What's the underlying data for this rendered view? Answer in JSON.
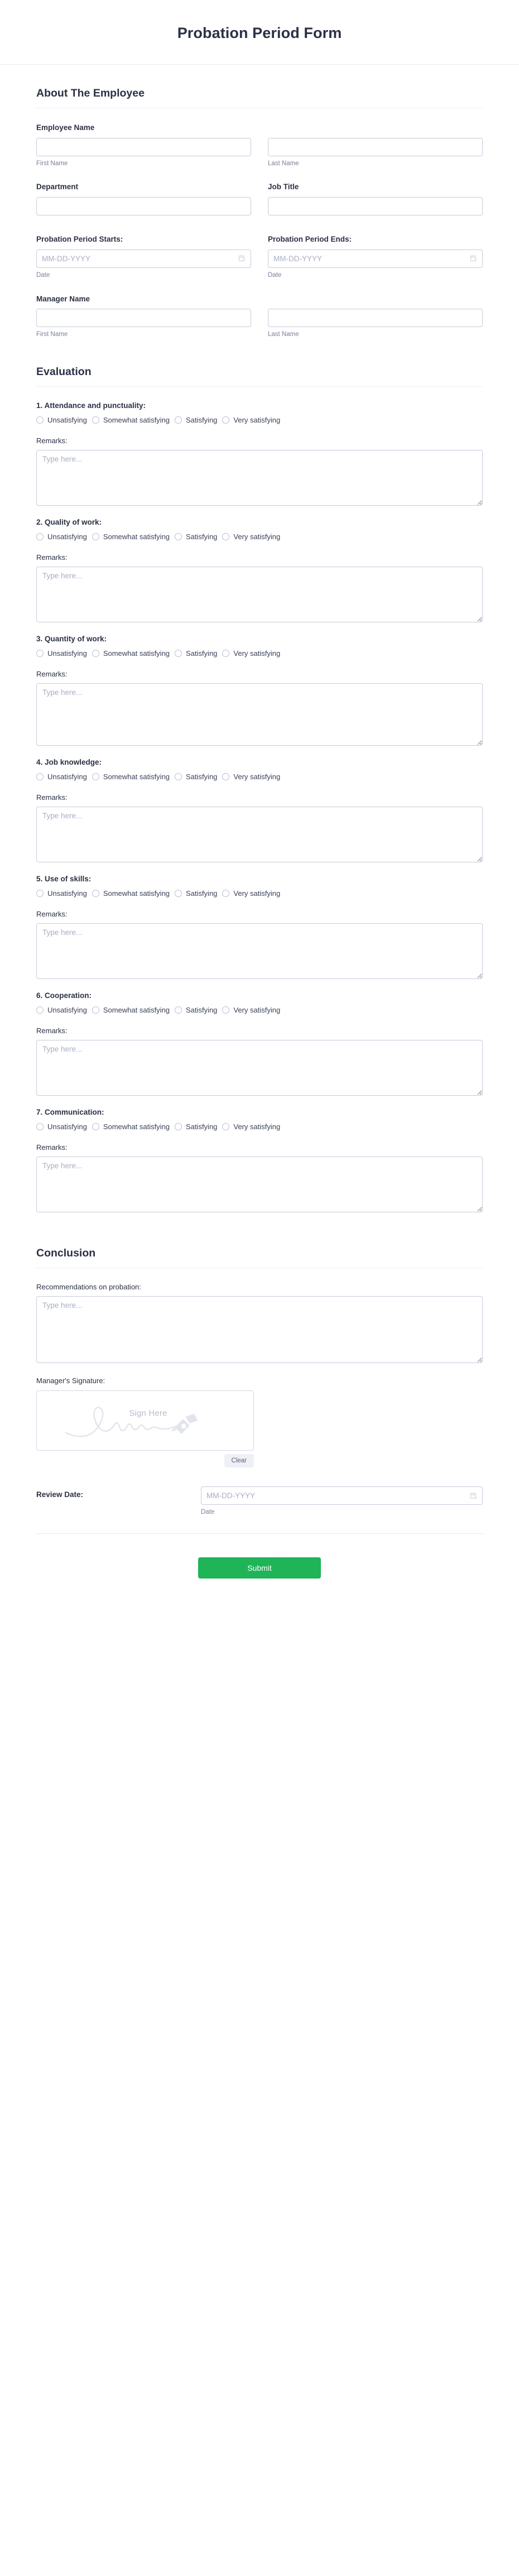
{
  "header": {
    "title": "Probation Period Form"
  },
  "sections": {
    "about": {
      "heading": "About The Employee",
      "employee_name": {
        "label": "Employee Name",
        "first_sub": "First Name",
        "last_sub": "Last Name",
        "first_value": "",
        "last_value": "",
        "first_placeholder": "",
        "last_placeholder": ""
      },
      "department": {
        "label": "Department",
        "value": "",
        "placeholder": ""
      },
      "job_title": {
        "label": "Job Title",
        "value": "",
        "placeholder": ""
      },
      "probation_start": {
        "label": "Probation Period Starts:",
        "placeholder": "MM-DD-YYYY",
        "value": "",
        "sub": "Date",
        "icon": "calendar-icon"
      },
      "probation_end": {
        "label": "Probation Period Ends:",
        "placeholder": "MM-DD-YYYY",
        "value": "",
        "sub": "Date",
        "icon": "calendar-icon"
      },
      "manager_name": {
        "label": "Manager Name",
        "first_sub": "First Name",
        "last_sub": "Last Name",
        "first_value": "",
        "last_value": "",
        "first_placeholder": "",
        "last_placeholder": ""
      }
    },
    "evaluation": {
      "heading": "Evaluation",
      "scale_options": [
        "Unsatisfying",
        "Somewhat satisfying",
        "Satisfying",
        "Very satisfying"
      ],
      "remarks_label": "Remarks:",
      "remarks_placeholder": "Type here...",
      "questions": [
        {
          "title": "1. Attendance and punctuality:",
          "remarks_value": ""
        },
        {
          "title": "2. Quality of work:",
          "remarks_value": ""
        },
        {
          "title": "3. Quantity of work:",
          "remarks_value": ""
        },
        {
          "title": "4. Job knowledge:",
          "remarks_value": ""
        },
        {
          "title": "5. Use of skills:",
          "remarks_value": ""
        },
        {
          "title": "6. Cooperation:",
          "remarks_value": ""
        },
        {
          "title": "7. Communication:",
          "remarks_value": ""
        }
      ]
    },
    "conclusion": {
      "heading": "Conclusion",
      "recommendations": {
        "label": "Recommendations on probation:",
        "placeholder": "Type here...",
        "value": ""
      },
      "signature": {
        "label": "Manager's Signature:",
        "pad_hint": "Sign Here",
        "pen_icon": "pen-nib-icon",
        "clear_label": "Clear"
      },
      "review_date": {
        "label": "Review Date:",
        "placeholder": "MM-DD-YYYY",
        "value": "",
        "sub": "Date",
        "icon": "calendar-icon"
      }
    }
  },
  "footer": {
    "submit_label": "Submit"
  },
  "colors": {
    "accent_green": "#1fb457",
    "text": "#2b3044",
    "muted": "#7b809b",
    "border": "#c8cbda"
  }
}
